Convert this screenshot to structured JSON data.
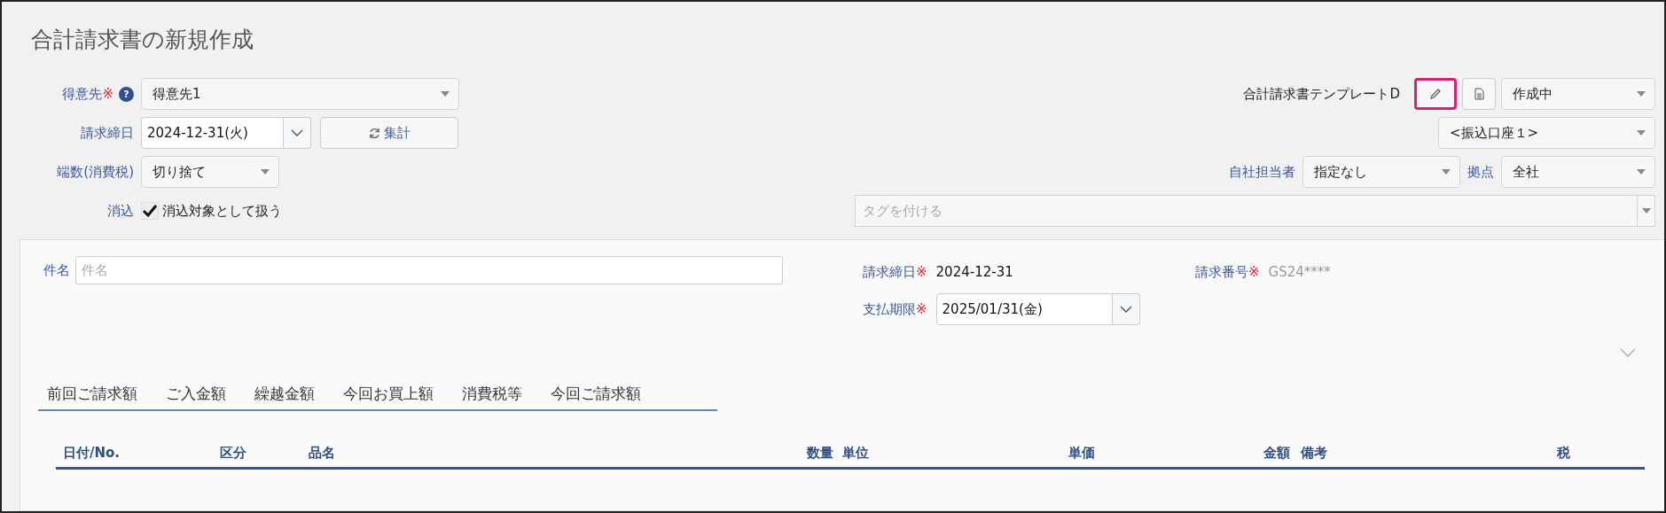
{
  "page_title": "合計請求書の新規作成",
  "header_left": [
    {
      "kind": "select",
      "label": "得意先",
      "required": true,
      "help": "?",
      "value": "得意先1"
    },
    {
      "kind": "date",
      "label": "請求締日",
      "required": false,
      "value": "2024-12-31(火)",
      "button": "集計"
    },
    {
      "kind": "select_small",
      "label": "端数(消費税)",
      "required": false,
      "value": "切り捨て"
    },
    {
      "kind": "checkbox",
      "label": "消込",
      "required": false,
      "value": "消込対象として扱う",
      "checked": true
    }
  ],
  "header_right": {
    "template": "合計請求書テンプレートD",
    "edit_button_highlighted": true,
    "status": "作成中",
    "account": "<振込口座１>",
    "staff_label": "自社担当者",
    "staff": "指定なし",
    "branch_label": "拠点",
    "branch": "全社",
    "tags_placeholder": "タグを付ける"
  },
  "subject": {
    "label": "件名",
    "placeholder": "件名"
  },
  "closing_date": {
    "label": "請求締日",
    "value": "2024-12-31"
  },
  "invoice_number": {
    "label": "請求番号",
    "value": "GS24****"
  },
  "due_date": {
    "label": "支払期限",
    "value": "2025/01/31(金)"
  },
  "required_mark": "※",
  "summary_tabs": [
    {
      "label": "前回ご請求額",
      "selected": false
    },
    {
      "label": "ご入金額",
      "selected": false
    },
    {
      "label": "繰越金額",
      "selected": false
    },
    {
      "label": "今回お買上額",
      "selected": false
    },
    {
      "label": "消費税等",
      "selected": false
    },
    {
      "label": "今回ご請求額",
      "selected": false
    }
  ],
  "table": {
    "columns": [
      {
        "label": "日付/No."
      },
      {
        "label": "区分"
      },
      {
        "label": "品名"
      },
      {
        "label": "数量"
      },
      {
        "label": "単位"
      },
      {
        "label": "単価"
      },
      {
        "label": "金額"
      },
      {
        "label": "備考"
      },
      {
        "label": "税"
      }
    ]
  }
}
